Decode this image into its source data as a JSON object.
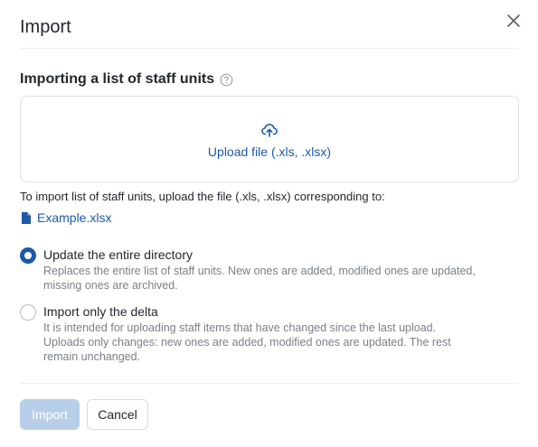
{
  "dialog": {
    "title": "Import",
    "close_icon": "close-icon"
  },
  "section": {
    "title": "Importing a list of staff units",
    "help_icon": "question-circle-icon"
  },
  "upload": {
    "icon": "cloud-upload-icon",
    "label": "Upload file (.xls, .xlsx)"
  },
  "hint": "To import list of staff units, upload the file (.xls, .xlsx) corresponding to:",
  "example": {
    "icon": "file-icon",
    "label": "Example.xlsx"
  },
  "options": [
    {
      "label": "Update the entire directory",
      "description": "Replaces the entire list of staff units. New ones are added, modified ones are updated,\nmissing ones are archived.",
      "checked": true
    },
    {
      "label": "Import only the delta",
      "description": "It is intended for uploading staff items that have changed since the last upload.\nUploads only changes: new ones are added, modified ones are updated. The rest\nremain unchanged.",
      "checked": false
    }
  ],
  "footer": {
    "import_label": "Import",
    "import_disabled": true,
    "cancel_label": "Cancel"
  },
  "colors": {
    "accent": "#1c5aa8",
    "disabled_button": "#b8cfe9"
  }
}
